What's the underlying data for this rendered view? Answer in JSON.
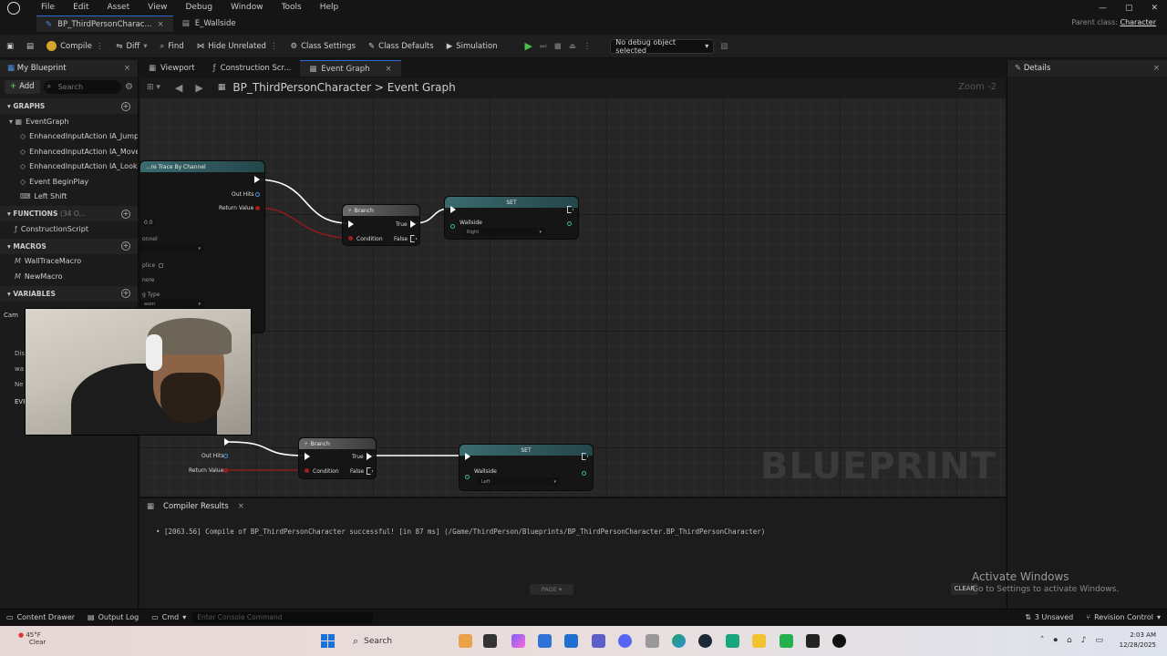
{
  "menu": {
    "items": [
      "File",
      "Edit",
      "Asset",
      "View",
      "Debug",
      "Window",
      "Tools",
      "Help"
    ]
  },
  "window": {
    "minimize": "—",
    "maximize": "▢",
    "close": "✕",
    "parent_label": "Parent class:",
    "parent_value": "Character"
  },
  "doc_tabs": [
    {
      "label": "BP_ThirdPersonCharac...",
      "close": "×"
    },
    {
      "label": "E_Wallside",
      "close": "×"
    }
  ],
  "toolbar": {
    "compile": "Compile",
    "diff": "Diff",
    "find": "Find",
    "hide_unrelated": "Hide Unrelated",
    "class_settings": "Class Settings",
    "class_defaults": "Class Defaults",
    "simulation": "Simulation",
    "debug_object": "No debug object selected"
  },
  "my_blueprint": {
    "tab": "My Blueprint",
    "add": "Add",
    "search_placeholder": "Search",
    "graphs_header": "GRAPHS",
    "graphs": [
      "EventGraph",
      "EnhancedInputAction IA_Jump",
      "EnhancedInputAction IA_Move",
      "EnhancedInputAction IA_Look",
      "Event BeginPlay",
      "Left Shift"
    ],
    "functions_header": "FUNCTIONS",
    "functions_count": "(34 O...",
    "functions": [
      "ConstructionScript"
    ],
    "macros_header": "MACROS",
    "macros": [
      "WallTraceMacro",
      "NewMacro"
    ],
    "variables_header": "VARIABLES",
    "variable_fragments": [
      "Cam",
      "Dis",
      "wa",
      "Ne",
      "EVE"
    ]
  },
  "graph_tabs": [
    {
      "label": "Viewport"
    },
    {
      "label": "Construction Scr..."
    },
    {
      "label": "Event Graph",
      "close": "×"
    }
  ],
  "graph": {
    "breadcrumb_root": "BP_ThirdPersonCharacter",
    "breadcrumb_sep": ">",
    "breadcrumb_leaf": "Event Graph",
    "zoom": "Zoom -2",
    "watermark": "BLUEPRINT",
    "trace_node": {
      "title": "...re Trace By Channel",
      "out_hits": "Out Hits",
      "return_value": "Return Value",
      "fragments": [
        "0.0",
        "onnel",
        "plice",
        "nore",
        "g Type",
        "ason"
      ]
    },
    "branch_top": {
      "title": "Branch",
      "true": "True",
      "false": "False",
      "condition": "Condition"
    },
    "set_top": {
      "title": "SET",
      "var": "Wallside",
      "value": "Right"
    },
    "branch_bottom": {
      "title": "Branch",
      "true": "True",
      "false": "False",
      "condition": "Condition",
      "out_hits": "Out Hits",
      "return_value": "Return Value"
    },
    "set_bottom": {
      "title": "SET",
      "var": "Wallside",
      "value": "Left"
    }
  },
  "details": {
    "tab": "Details"
  },
  "compiler": {
    "tab": "Compiler Results",
    "message": "[2063.56] Compile of BP_ThirdPersonCharacter successful! [in 87 ms] (/Game/ThirdPerson/Blueprints/BP_ThirdPersonCharacter.BP_ThirdPersonCharacter)",
    "page": "PAGE",
    "clear": "CLEAR"
  },
  "activate": {
    "title": "Activate Windows",
    "subtitle": "Go to Settings to activate Windows."
  },
  "statusbar": {
    "content_drawer": "Content Drawer",
    "output_log": "Output Log",
    "cmd": "Cmd",
    "console_placeholder": "Enter Console Command",
    "unsaved": "3 Unsaved",
    "revision": "Revision Control"
  },
  "taskbar": {
    "temp": "45°F",
    "weather": "Clear",
    "search": "Search",
    "time": "2:03 AM",
    "date": "12/28/2025"
  },
  "colors": {
    "accent": "#2b6cd5",
    "exec_green": "#4cbb4c",
    "bool_red": "#a01d1d"
  }
}
